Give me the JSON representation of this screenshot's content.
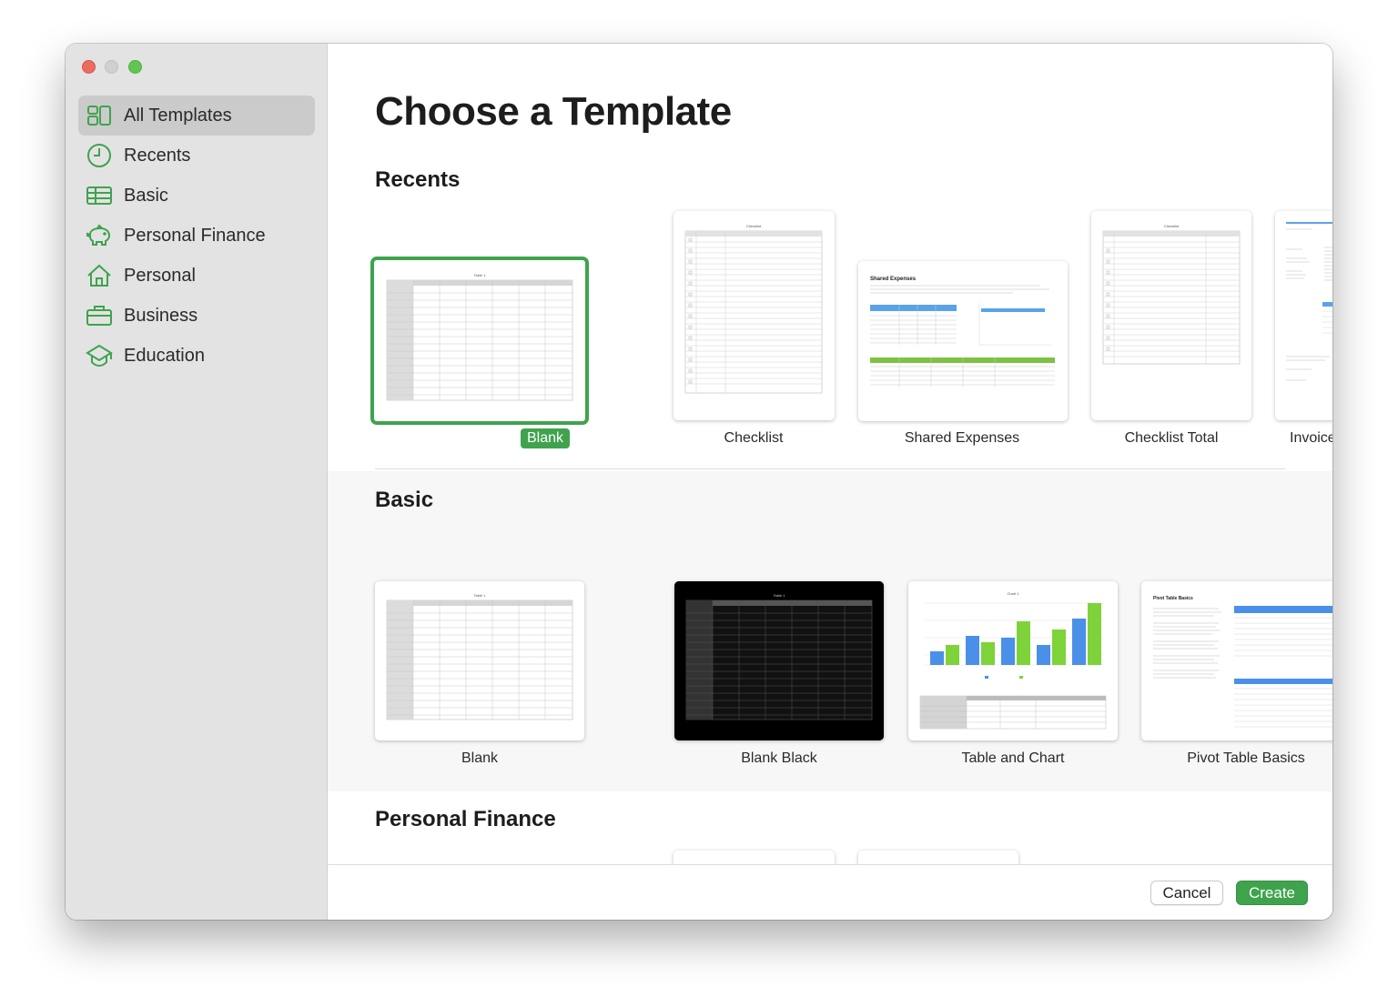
{
  "window": {
    "traffic_lights": [
      "close",
      "minimize",
      "zoom"
    ]
  },
  "sidebar": {
    "accent_color": "#3fa34d",
    "items": [
      {
        "label": "All Templates",
        "icon": "grid-icon",
        "active": true
      },
      {
        "label": "Recents",
        "icon": "clock-icon",
        "active": false
      },
      {
        "label": "Basic",
        "icon": "table-icon",
        "active": false
      },
      {
        "label": "Personal Finance",
        "icon": "piggy-bank-icon",
        "active": false
      },
      {
        "label": "Personal",
        "icon": "house-icon",
        "active": false
      },
      {
        "label": "Business",
        "icon": "briefcase-icon",
        "active": false
      },
      {
        "label": "Education",
        "icon": "graduation-cap-icon",
        "active": false
      }
    ]
  },
  "main": {
    "title": "Choose a Template",
    "sections": {
      "recents": {
        "title": "Recents",
        "templates": [
          {
            "label": "Blank",
            "selected": true
          },
          {
            "label": "Checklist"
          },
          {
            "label": "Shared Expenses"
          },
          {
            "label": "Checklist Total"
          },
          {
            "label": "Invoice"
          }
        ]
      },
      "basic": {
        "title": "Basic",
        "templates": [
          {
            "label": "Blank"
          },
          {
            "label": "Blank Black"
          },
          {
            "label": "Table and Chart"
          },
          {
            "label": "Pivot Table Basics"
          }
        ]
      },
      "personal_finance": {
        "title": "Personal Finance"
      }
    }
  },
  "footer": {
    "cancel_label": "Cancel",
    "create_label": "Create"
  },
  "colors": {
    "accent": "#3fa34d",
    "sidebar_bg": "#e3e3e3",
    "selected_nav": "#cbcbcb"
  }
}
